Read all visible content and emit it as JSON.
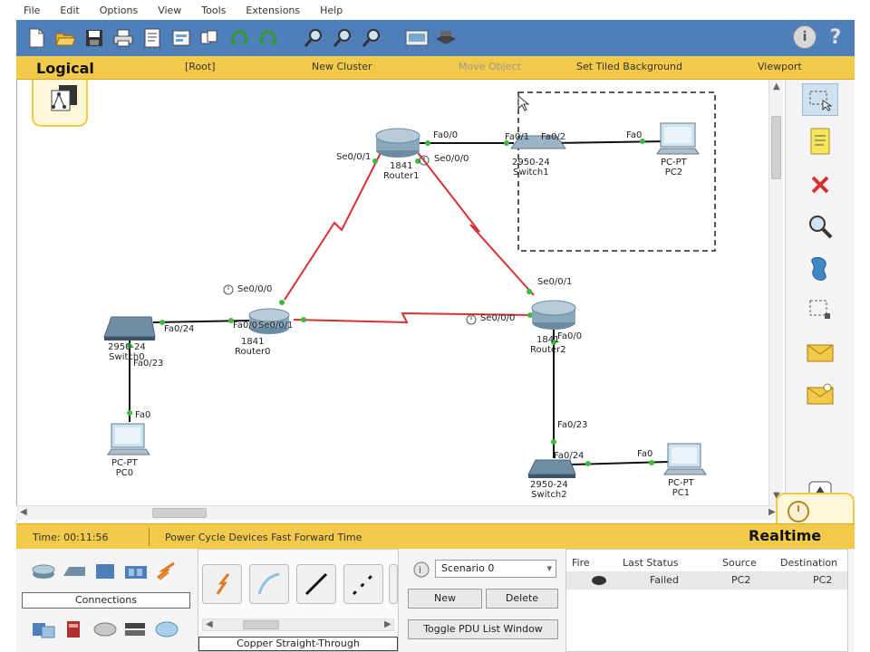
{
  "menubar": {
    "items": [
      "File",
      "Edit",
      "Options",
      "View",
      "Tools",
      "Extensions",
      "Help"
    ]
  },
  "toolbar": {
    "icons": [
      "new-file-icon",
      "open-folder-icon",
      "save-icon",
      "print-icon",
      "activity-wizard-icon",
      "network-info-icon",
      "copy-icon",
      "undo-icon",
      "redo-icon",
      "zoom-in-icon",
      "zoom-reset-icon",
      "zoom-out-icon",
      "palette-icon",
      "custom-device-icon",
      "info-icon",
      "help-icon"
    ]
  },
  "logical_bar": {
    "title": "Logical",
    "items": [
      "[Root]",
      "New Cluster",
      "Move Object",
      "Set Tiled Background",
      "Viewport"
    ]
  },
  "topology": {
    "devices": [
      {
        "name": "Router1",
        "model": "1841",
        "kind": "router"
      },
      {
        "name": "Router0",
        "model": "1841",
        "kind": "router"
      },
      {
        "name": "Router2",
        "model": "1841",
        "kind": "router"
      },
      {
        "name": "Switch1",
        "model": "2950-24",
        "kind": "switch"
      },
      {
        "name": "Switch0",
        "model": "2950-24",
        "kind": "switch"
      },
      {
        "name": "Switch2",
        "model": "2950-24",
        "kind": "switch"
      },
      {
        "name": "PC2",
        "model": "PC-PT",
        "kind": "pc"
      },
      {
        "name": "PC0",
        "model": "PC-PT",
        "kind": "pc"
      },
      {
        "name": "PC1",
        "model": "PC-PT",
        "kind": "pc"
      }
    ],
    "ports": {
      "r1_se001": "Se0/0/1",
      "r1_fa00": "Fa0/0",
      "r1_se000": "Se0/0/0",
      "s1_fa01": "Fa0/1",
      "s1_fa02": "Fa0/2",
      "pc2_fa0": "Fa0",
      "r0_se000": "Se0/0/0",
      "r0_fa00": "Fa0/0",
      "r0_se001": "Se0/0/1",
      "s0_fa024": "Fa0/24",
      "s0_fa023": "Fa0/23",
      "pc0_fa0": "Fa0",
      "r2_se001": "Se0/0/1",
      "r2_se000": "Se0/0/0",
      "r2_fa00": "Fa0/0",
      "s2_fa023": "Fa0/23",
      "s2_fa024": "Fa0/24",
      "pc1_fa0": "Fa0"
    }
  },
  "statusbar": {
    "time": "Time: 00:11:56",
    "power_cycle": "Power Cycle Devices  Fast Forward Time",
    "realtime": "Realtime"
  },
  "bottom": {
    "device_category_label": "Connections",
    "cable_label": "Copper Straight-Through",
    "scenario": "Scenario 0",
    "new_button": "New",
    "delete_button": "Delete",
    "toggle_button": "Toggle PDU List Window",
    "pdu_headers": [
      "Fire",
      "Last Status",
      "Source",
      "Destination"
    ],
    "pdu_rows": [
      {
        "status": "Failed",
        "source": "PC2",
        "destination": "PC2"
      }
    ]
  },
  "colors": {
    "toolbar_bg": "#4f7fb8",
    "logical_bar_bg": "#f3c94a",
    "serial_link": "#d93030",
    "ethernet_link": "#111111",
    "port_up": "#3cba3c"
  }
}
